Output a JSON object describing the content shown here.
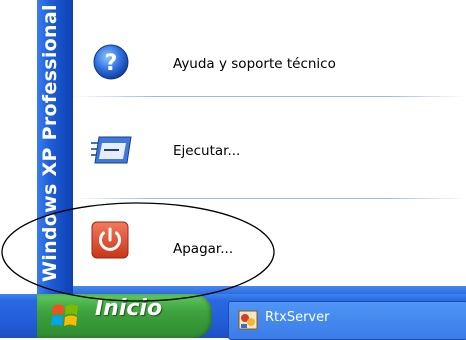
{
  "sidebar_label": "Windows XP Professional",
  "menu": {
    "items": [
      {
        "label": "Ayuda y soporte técnico",
        "icon": "help-icon"
      },
      {
        "label": "Ejecutar...",
        "icon": "run-icon"
      },
      {
        "label": "Apagar...",
        "icon": "power-icon"
      }
    ]
  },
  "taskbar": {
    "start_label": "Inicio",
    "task_label": "RtxServer"
  },
  "colors": {
    "sidebar": "#1f5fd8",
    "taskbar": "#245edb",
    "start_button": "#3ea33e",
    "power_red": "#e0492e"
  }
}
